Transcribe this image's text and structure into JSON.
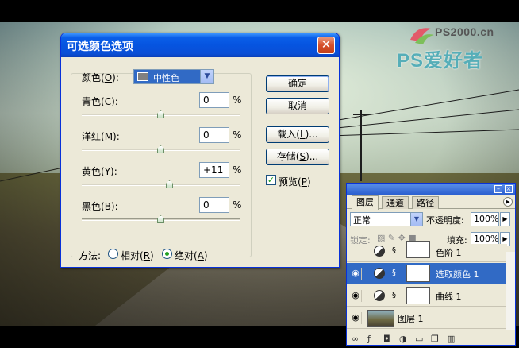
{
  "watermark": {
    "site": "PS2000.cn",
    "name": "PS爱好者"
  },
  "dialog": {
    "title": "可选颜色选项",
    "close_label": "✕",
    "colors_label": "颜色(",
    "colors_key": "O",
    "colors_close": "):",
    "colors_value": "中性色",
    "sliders": [
      {
        "label": "青色(",
        "key": "C",
        "close": "):",
        "value": "0",
        "unit": "%",
        "position": 0.5
      },
      {
        "label": "洋红(",
        "key": "M",
        "close": "):",
        "value": "0",
        "unit": "%",
        "position": 0.5
      },
      {
        "label": "黄色(",
        "key": "Y",
        "close": "):",
        "value": "+11",
        "unit": "%",
        "position": 0.555
      },
      {
        "label": "黑色(",
        "key": "B",
        "close": "):",
        "value": "0",
        "unit": "%",
        "position": 0.5
      }
    ],
    "method_label": "方法:",
    "method_options": [
      {
        "label": "相对(",
        "key": "R",
        "close": ")",
        "selected": false
      },
      {
        "label": "绝对(",
        "key": "A",
        "close": ")",
        "selected": true
      }
    ],
    "buttons": {
      "ok": "确定",
      "cancel": "取消",
      "load": "载入(",
      "load_key": "L",
      "load_close": ")...",
      "save": "存储(",
      "save_key": "S",
      "save_close": ")..."
    },
    "preview_label": "预览(",
    "preview_key": "P",
    "preview_close": ")",
    "preview_checked": true
  },
  "layers_panel": {
    "tabs": [
      "图层",
      "通道",
      "路径"
    ],
    "active_tab": 0,
    "blend_mode": "正常",
    "opacity_label": "不透明度:",
    "opacity_value": "100%",
    "lock_label": "锁定:",
    "fill_label": "填充:",
    "fill_value": "100%",
    "layers": [
      {
        "name": "色阶 1",
        "selected": false
      },
      {
        "name": "选取颜色 1",
        "selected": true
      },
      {
        "name": "曲线 1",
        "selected": false
      },
      {
        "name": "图层 1",
        "selected": false
      }
    ]
  },
  "colors": {
    "title_bar": "#0654e0",
    "selection": "#316ac5",
    "dialog_bg": "#ece9d8",
    "check": "#21a121"
  }
}
